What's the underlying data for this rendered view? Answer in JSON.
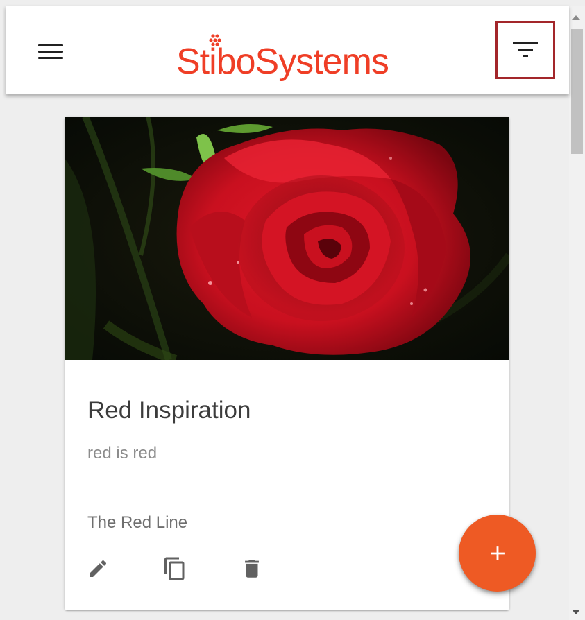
{
  "header": {
    "logo_text": "StiboSystems",
    "brand_color": "#ef3e26",
    "menu_icon": "hamburger-menu-icon",
    "filter_icon": "filter-list-icon",
    "filter_highlight_color": "#a3262a"
  },
  "card": {
    "image_subject": "red-rose",
    "title": "Red Inspiration",
    "subtitle": "red is red",
    "collection": "The Red Line",
    "actions": [
      {
        "icon": "pencil-icon"
      },
      {
        "icon": "copy-icon"
      },
      {
        "icon": "trash-icon"
      }
    ]
  },
  "fab": {
    "label": "+",
    "color": "#ee5a24"
  }
}
